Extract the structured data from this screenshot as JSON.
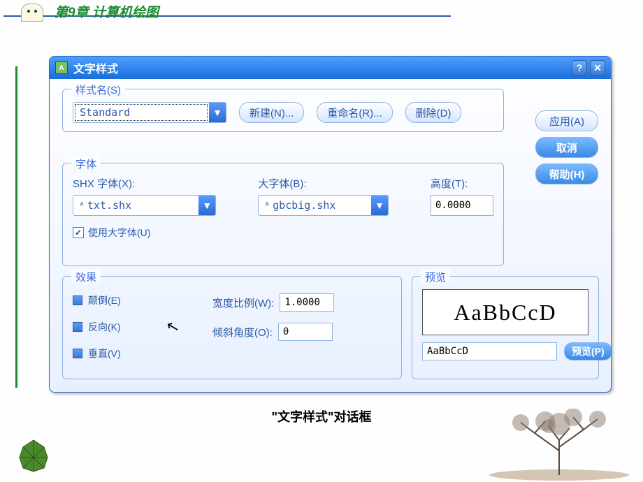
{
  "header": {
    "title": "第9章  计算机绘图"
  },
  "dialog": {
    "title": "文字样式",
    "style_name": {
      "legend": "样式名(S)",
      "selected": "Standard",
      "new_btn": "新建(N)...",
      "rename_btn": "重命名(R)...",
      "delete_btn": "删除(D)"
    },
    "font": {
      "legend": "字体",
      "shx_label": "SHX 字体(X):",
      "shx_value": "txt.shx",
      "big_label": "大字体(B):",
      "big_value": "gbcbig.shx",
      "height_label": "高度(T):",
      "height_value": "0.0000",
      "use_big_label": "使用大字体(U)"
    },
    "effects": {
      "legend": "效果",
      "upside_down": "颠倒(E)",
      "backwards": "反向(K)",
      "vertical": "垂直(V)",
      "width_label": "宽度比例(W):",
      "width_value": "1.0000",
      "oblique_label": "倾斜角度(O):",
      "oblique_value": "0"
    },
    "preview": {
      "legend": "预览",
      "sample": "AaBbCcD",
      "input_value": "AaBbCcD",
      "preview_btn": "预览(P)"
    },
    "side": {
      "apply": "应用(A)",
      "cancel": "取消",
      "help": "帮助(H)"
    }
  },
  "caption": "\"文字样式\"对话框"
}
